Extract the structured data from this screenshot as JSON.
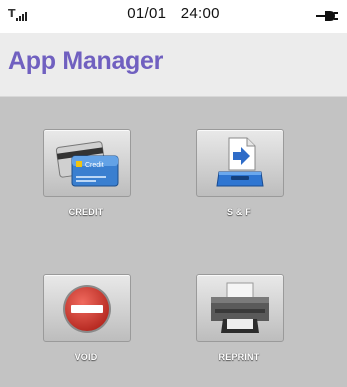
{
  "status_bar": {
    "signal_label": "T",
    "date": "01/01",
    "time": "24:00"
  },
  "header": {
    "title": "App Manager"
  },
  "apps": [
    {
      "label": "CREDIT",
      "icon": "credit-card-icon"
    },
    {
      "label": "S & F",
      "icon": "document-tray-icon"
    },
    {
      "label": "VOID",
      "icon": "no-entry-icon"
    },
    {
      "label": "REPRINT",
      "icon": "printer-icon"
    }
  ],
  "icon_texts": {
    "credit_card_text": "Credit"
  },
  "colors": {
    "title": "#7060c0",
    "background": "#c3c3c3",
    "header_background": "#ececec"
  }
}
